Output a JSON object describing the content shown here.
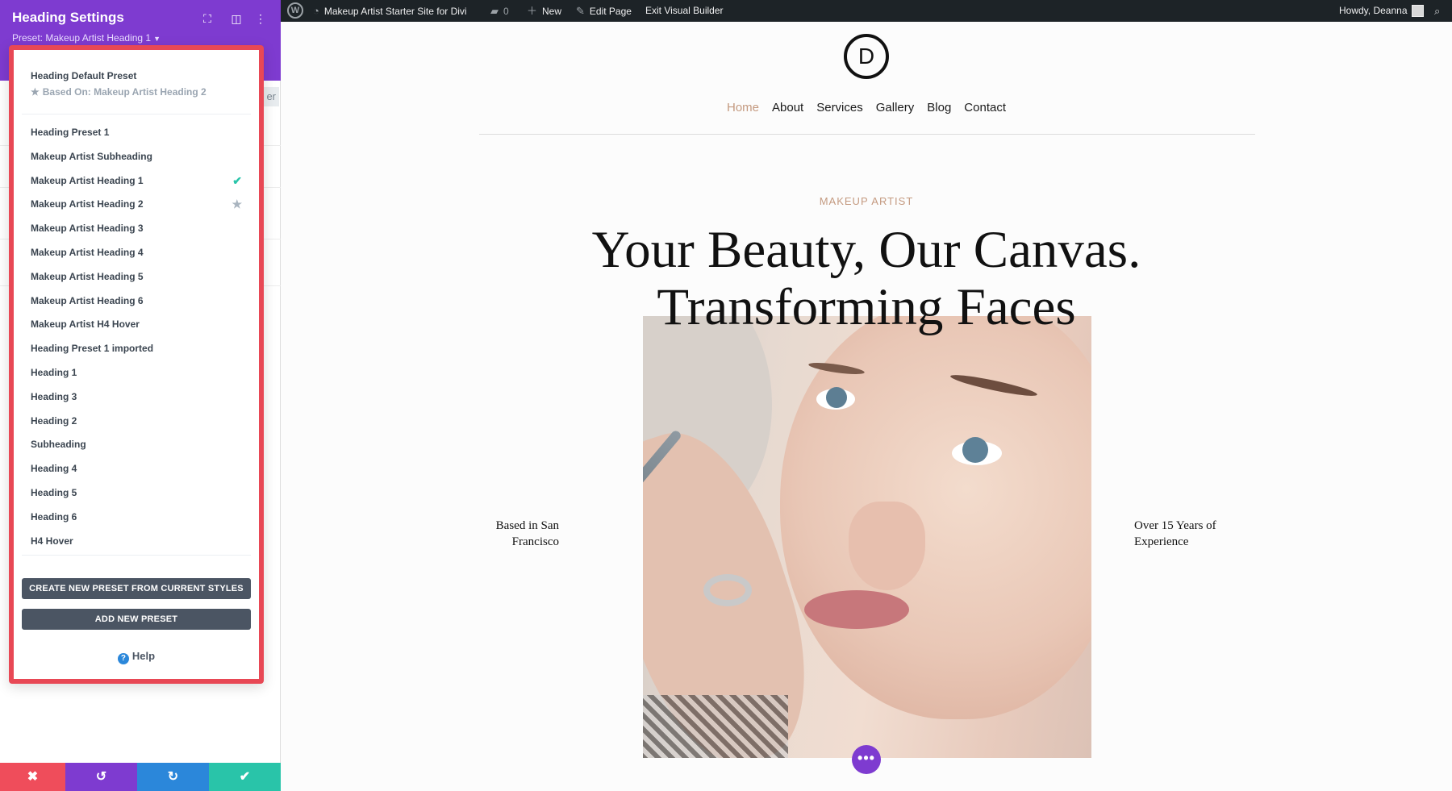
{
  "panel": {
    "title": "Heading Settings",
    "preset_label": "Preset: Makeup Artist Heading 1",
    "peek_button_text": "er"
  },
  "dropdown": {
    "default_preset": "Heading Default Preset",
    "based_on": "Based On: Makeup Artist Heading 2",
    "presets": [
      {
        "label": "Heading Preset 1",
        "mark": ""
      },
      {
        "label": "Makeup Artist Subheading",
        "mark": ""
      },
      {
        "label": "Makeup Artist Heading 1",
        "mark": "check-icon"
      },
      {
        "label": "Makeup Artist Heading 2",
        "mark": "star-icon"
      },
      {
        "label": "Makeup Artist Heading 3",
        "mark": ""
      },
      {
        "label": "Makeup Artist Heading 4",
        "mark": ""
      },
      {
        "label": "Makeup Artist Heading 5",
        "mark": ""
      },
      {
        "label": "Makeup Artist Heading 6",
        "mark": ""
      },
      {
        "label": "Makeup Artist H4 Hover",
        "mark": ""
      },
      {
        "label": "Heading Preset 1 imported",
        "mark": ""
      },
      {
        "label": "Heading 1",
        "mark": ""
      },
      {
        "label": "Heading 3",
        "mark": ""
      },
      {
        "label": "Heading 2",
        "mark": ""
      },
      {
        "label": "Subheading",
        "mark": ""
      },
      {
        "label": "Heading 4",
        "mark": ""
      },
      {
        "label": "Heading 5",
        "mark": ""
      },
      {
        "label": "Heading 6",
        "mark": ""
      },
      {
        "label": "H4 Hover",
        "mark": ""
      }
    ],
    "create_button": "CREATE NEW PRESET FROM CURRENT STYLES",
    "add_button": "ADD NEW PRESET",
    "help": "Help"
  },
  "adminbar": {
    "site_name": "Makeup Artist Starter Site for Divi",
    "comments_count": "0",
    "new_label": "New",
    "edit_page": "Edit Page",
    "exit_builder": "Exit Visual Builder",
    "howdy": "Howdy, Deanna"
  },
  "site": {
    "logo_letter": "D",
    "nav": [
      "Home",
      "About",
      "Services",
      "Gallery",
      "Blog",
      "Contact"
    ],
    "active_nav": "Home",
    "eyebrow": "MAKEUP ARTIST",
    "headline_line1": "Your Beauty, Our Canvas.",
    "headline_line2": "Transforming Faces",
    "left_text": "Based in San Francisco",
    "right_text": "Over 15 Years of Experience"
  },
  "colors": {
    "builder_purple": "#7e3bd0",
    "highlight_red": "#e84855",
    "accent_tan": "#c49a80",
    "check_teal": "#29c4a9",
    "close_red": "#ef4d5b",
    "redo_blue": "#2b87da"
  }
}
